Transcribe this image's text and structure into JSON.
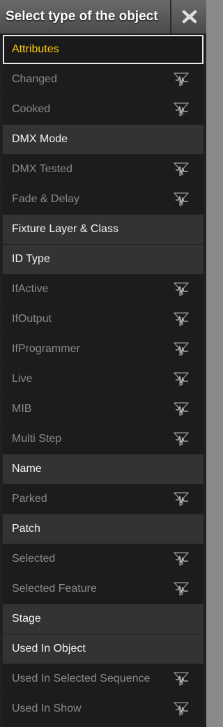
{
  "dialog": {
    "title": "Select type of the object",
    "close_icon": "close-icon"
  },
  "items": [
    {
      "label": "Attributes",
      "kind": "selected",
      "filter": false
    },
    {
      "label": "Changed",
      "kind": "leaf",
      "filter": true
    },
    {
      "label": "Cooked",
      "kind": "leaf",
      "filter": true
    },
    {
      "label": "DMX Mode",
      "kind": "group",
      "filter": false
    },
    {
      "label": "DMX Tested",
      "kind": "leaf",
      "filter": true
    },
    {
      "label": "Fade & Delay",
      "kind": "leaf",
      "filter": true
    },
    {
      "label": "Fixture Layer & Class",
      "kind": "group",
      "filter": false
    },
    {
      "label": "ID Type",
      "kind": "group",
      "filter": false
    },
    {
      "label": "IfActive",
      "kind": "leaf",
      "filter": true
    },
    {
      "label": "IfOutput",
      "kind": "leaf",
      "filter": true
    },
    {
      "label": "IfProgrammer",
      "kind": "leaf",
      "filter": true
    },
    {
      "label": "Live",
      "kind": "leaf",
      "filter": true
    },
    {
      "label": "MIB",
      "kind": "leaf",
      "filter": true
    },
    {
      "label": "Multi Step",
      "kind": "leaf",
      "filter": true
    },
    {
      "label": "Name",
      "kind": "group",
      "filter": false
    },
    {
      "label": "Parked",
      "kind": "leaf",
      "filter": true
    },
    {
      "label": "Patch",
      "kind": "group",
      "filter": false
    },
    {
      "label": "Selected",
      "kind": "leaf",
      "filter": true
    },
    {
      "label": "Selected Feature",
      "kind": "leaf",
      "filter": true
    },
    {
      "label": "Stage",
      "kind": "group",
      "filter": false
    },
    {
      "label": "Used In Object",
      "kind": "group",
      "filter": false
    },
    {
      "label": "Used In Selected Sequence",
      "kind": "leaf",
      "filter": true
    },
    {
      "label": "Used In Show",
      "kind": "leaf",
      "filter": true
    }
  ],
  "icons": {
    "filter": "filter-icon"
  },
  "colors": {
    "selected_text": "#ffcc00",
    "group_text": "#f2f2f2",
    "leaf_text": "#8a8a8a"
  }
}
